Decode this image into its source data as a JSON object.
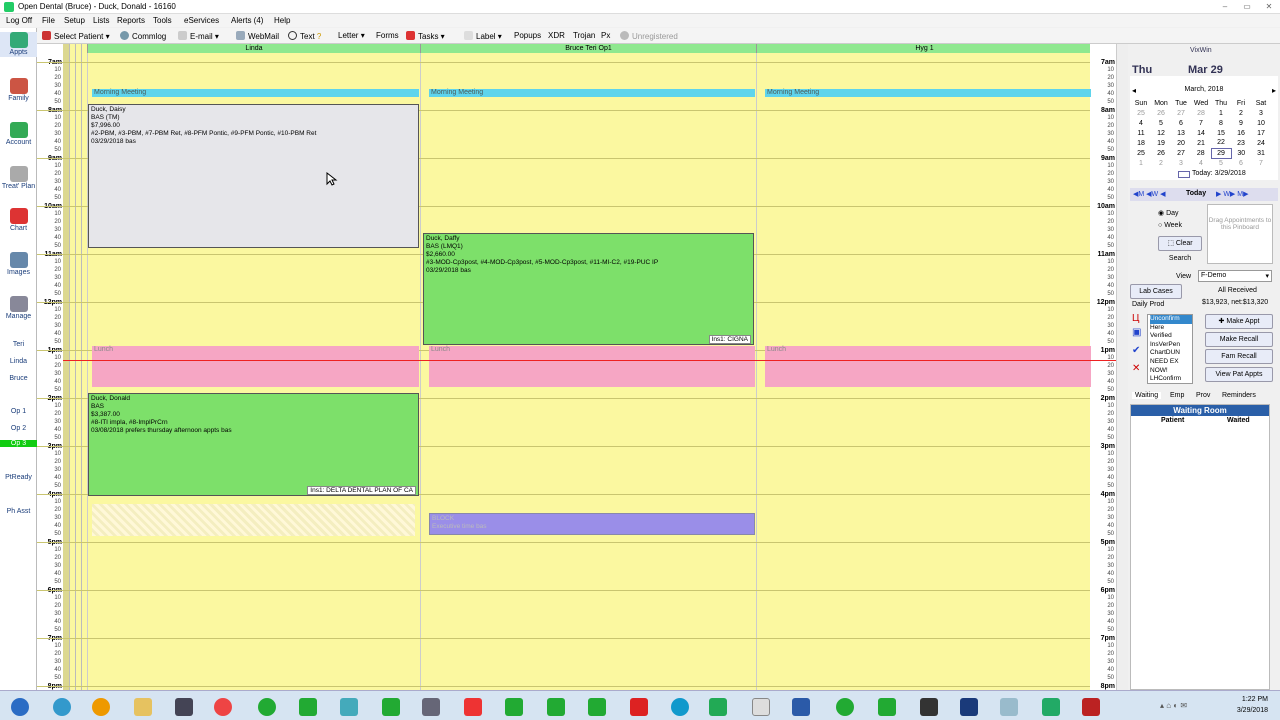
{
  "window": {
    "title": "Open Dental (Bruce) - Duck, Donald - 16160"
  },
  "menu": [
    "Log Off",
    "File",
    "Setup",
    "Lists",
    "Reports",
    "Tools",
    "eServices",
    "Alerts (4)",
    "Help"
  ],
  "toolbar": {
    "select_patient": "Select Patient",
    "commlog": "Commlog",
    "email": "E-mail",
    "webmail": "WebMail",
    "text": "Text",
    "letter": "Letter",
    "forms": "Forms",
    "tasks": "Tasks",
    "label": "Label",
    "popups": "Popups",
    "xdr": "XDR",
    "trojan": "Trojan",
    "px": "Px",
    "unregistered": "Unregistered"
  },
  "nav": {
    "appts": "Appts",
    "family": "Family",
    "account": "Account",
    "treat_plan": "Treat' Plan",
    "chart": "Chart",
    "images": "Images",
    "manage": "Manage"
  },
  "providers": [
    "Teri",
    "Linda",
    "Bruce"
  ],
  "operatories": [
    "Op 1",
    "Op 2",
    "Op 3",
    "PtReady",
    "Ph Asst"
  ],
  "columns": [
    "Linda",
    "Bruce  Teri Op1",
    "Hyg 1"
  ],
  "times": {
    "hours": [
      "7am",
      "8am",
      "9am",
      "10am",
      "11am",
      "12pm",
      "1pm",
      "2pm",
      "3pm",
      "4pm",
      "5pm",
      "6pm",
      "7pm",
      "8pm"
    ],
    "mins": [
      "10",
      "20",
      "30",
      "40",
      "50"
    ]
  },
  "blocks": {
    "meeting": "Morning Meeting",
    "lunch": "Lunch",
    "block_title": "BLOCK",
    "block_sub": "Executive time  bas"
  },
  "appts": [
    {
      "name": "Duck, Daisy",
      "line2": "BAS (TM)",
      "fee": "$7,996.00",
      "procs": "#2-PBM, #3-PBM, #7-PBM Ret, #8-PFM Pontic, #9-PFM Pontic, #10-PBM Ret",
      "note": "03/29/2018 bas",
      "ins": ""
    },
    {
      "name": "Duck, Daffy",
      "line2": "BAS (LMQ1)",
      "fee": "$2,660.00",
      "procs": "#3-MOD-Cp3post, #4-MOD-Cp3post, #5-MOD-Cp3post, #11-MI-C2, #19-PUC IP",
      "note": "03/29/2018  bas",
      "ins": "Ins1: CIGNA"
    },
    {
      "name": "Duck, Donald",
      "line2": "BAS",
      "fee": "$3,387.00",
      "procs": "#8-ITI impla, #8-ImplPrCrn",
      "note": "03/08/2018  prefers thursday afternoon appts  bas",
      "ins": "Ins1: DELTA DENTAL PLAN OF CA"
    }
  ],
  "right": {
    "user": "VixWin",
    "day": "Thu",
    "date": "Mar 29",
    "month": "March, 2018",
    "dow": [
      "Sun",
      "Mon",
      "Tue",
      "Wed",
      "Thu",
      "Fri",
      "Sat"
    ],
    "weeks": [
      [
        "25",
        "26",
        "27",
        "28",
        "1",
        "2",
        "3"
      ],
      [
        "4",
        "5",
        "6",
        "7",
        "8",
        "9",
        "10"
      ],
      [
        "11",
        "12",
        "13",
        "14",
        "15",
        "16",
        "17"
      ],
      [
        "18",
        "19",
        "20",
        "21",
        "22",
        "23",
        "24"
      ],
      [
        "25",
        "26",
        "27",
        "28",
        "29",
        "30",
        "31"
      ],
      [
        "1",
        "2",
        "3",
        "4",
        "5",
        "6",
        "7"
      ]
    ],
    "today": "Today: 3/29/2018",
    "nav_today": "Today",
    "day_opt": "Day",
    "week_opt": "Week",
    "clear": "Clear",
    "search": "Search",
    "pinboard": "Drag Appointments to this Pinboard",
    "view_label": "View",
    "view_value": "F-Demo",
    "lab_cases": "Lab Cases",
    "all_received": "All Received",
    "daily_prod": "Daily Prod",
    "prod_value": "$13,923, net:$13,320",
    "status": [
      "Unconfirm",
      "Here",
      "Verified",
      "InsVerPen",
      "ChartDUN",
      "NEED EX",
      "NOW!",
      "LHConfirm"
    ],
    "make_appt": "Make Appt",
    "make_recall": "Make Recall",
    "fam_recall": "Fam Recall",
    "view_pat_appts": "View Pat Appts",
    "tabs": [
      "Waiting",
      "Emp",
      "Prov",
      "Reminders"
    ],
    "waiting_room": "Waiting Room",
    "col_patient": "Patient",
    "col_waited": "Waited"
  },
  "clock": {
    "time": "1:22 PM",
    "date": "3/29/2018"
  }
}
